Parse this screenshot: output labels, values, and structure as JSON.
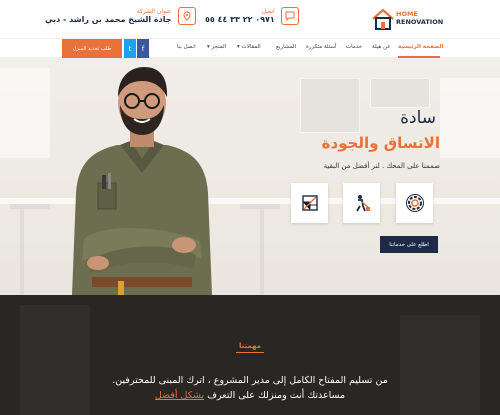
{
  "colors": {
    "accent": "#e8723a",
    "navy": "#1e2a47",
    "dark_section": "#2a2623"
  },
  "logo": {
    "line1": "HOME",
    "line2": "RENOVATION",
    "icon": "house-icon"
  },
  "topbar": {
    "phone_label": "اتصل",
    "phone_value": "٠٩٧١ ٢٢ ٣٣ ٤٤ ٥٥",
    "phone_icon": "chat-icon",
    "address_label": "عنوان الشركة",
    "address_value": "جادة الشيخ محمد بن راشد - دبي",
    "address_icon": "location-pin-icon"
  },
  "nav": {
    "items": [
      {
        "label": "الصفحة الرئيسية",
        "active": true
      },
      {
        "label": "عن هيلة"
      },
      {
        "label": "خدمات"
      },
      {
        "label": "أسئلة متكررة"
      },
      {
        "label": "المشاريع"
      },
      {
        "label": "المقالات",
        "dropdown": true
      },
      {
        "label": "المتجر",
        "dropdown": true
      },
      {
        "label": "اتصل بنا"
      }
    ],
    "cta": "طلب تجديد المنزل",
    "social": [
      {
        "name": "twitter-icon",
        "glyph": "t"
      },
      {
        "name": "facebook-icon",
        "glyph": "f"
      }
    ]
  },
  "hero": {
    "subtitle": "سادة",
    "title": "الاتساق والجودة",
    "description": "صممنا على المحك . لنر أفضل من البقية",
    "features": [
      "gear-icon",
      "cleaning-worker-icon",
      "blueprint-icon"
    ],
    "button": "اطلع على خدماتنا"
  },
  "mission": {
    "label": "مهمتنا",
    "line1": "من تسليم المفتاح الكامل إلى مدير المشروع ، اترك المبنى للمحترفين.",
    "line2_prefix": "مساعدتك أنت ومنزلك على التعرف",
    "line2_highlight": "بشكل أفضل"
  }
}
